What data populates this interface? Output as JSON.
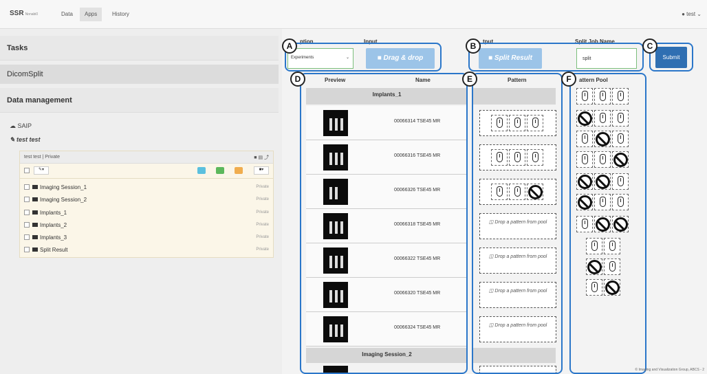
{
  "topbar": {
    "brand": "SSR",
    "brand_sub": "Nonabi0",
    "nav": [
      "Data",
      "Apps",
      "History"
    ],
    "user": "test"
  },
  "left": {
    "tasks_title": "Tasks",
    "task_item": "DicomSplit",
    "data_title": "Data management",
    "saip": "SAIP",
    "test_test": "test test",
    "tree_owner": "test test",
    "tree_visibility": "Private",
    "items": [
      {
        "label": "Imaging Session_1",
        "visibility": "Private"
      },
      {
        "label": "Imaging Session_2",
        "visibility": "Private"
      },
      {
        "label": "Implants_1",
        "visibility": "Private"
      },
      {
        "label": "Implants_2",
        "visibility": "Private"
      },
      {
        "label": "Implants_3",
        "visibility": "Private"
      },
      {
        "label": "Split Result",
        "visibility": "Private"
      }
    ],
    "colors": {
      "blue": "#5bc0de",
      "green": "#5cb85c",
      "orange": "#f0ad4e"
    }
  },
  "callouts": {
    "a": "A",
    "b": "B",
    "c": "C",
    "d": "D",
    "e": "E",
    "f": "F"
  },
  "form": {
    "option_label": "ption",
    "option_value": "Experiments",
    "input_label": "Input",
    "drag_drop": "Drag & drop",
    "output_label": "tput",
    "split_result": "Split Result",
    "job_label": "Split Job Name",
    "job_value": "split",
    "submit": "Submit"
  },
  "table": {
    "preview_header": "Preview",
    "name_header": "Name",
    "pattern_header": "Pattern",
    "pool_header": "attern Pool",
    "group1": "Implants_1",
    "group2": "Imaging Session_2",
    "rows": [
      {
        "name": "00066314 TSE45 MR",
        "pattern": [
          "mouse",
          "mouse",
          "mouse"
        ]
      },
      {
        "name": "00066316 TSE45 MR",
        "pattern": [
          "mouse",
          "mouse",
          "mouse"
        ]
      },
      {
        "name": "00066326 TSE45 MR",
        "pattern": [
          "mouse",
          "mouse",
          "no"
        ]
      },
      {
        "name": "00066318 TSE45 MR",
        "pattern": null
      },
      {
        "name": "00066322 TSE45 MR",
        "pattern": null
      },
      {
        "name": "00066320 TSE45 MR",
        "pattern": null
      },
      {
        "name": "00066324 TSE45 MR",
        "pattern": null
      }
    ],
    "drop_text": "Drop a pattern from pool"
  },
  "pool": [
    [
      "mouse",
      "mouse",
      "mouse"
    ],
    [
      "no",
      "mouse",
      "mouse"
    ],
    [
      "mouse",
      "no",
      "mouse"
    ],
    [
      "mouse",
      "mouse",
      "no"
    ],
    [
      "no",
      "no",
      "mouse"
    ],
    [
      "no",
      "mouse",
      "mouse"
    ],
    [
      "mouse",
      "no",
      "no"
    ],
    [
      "mouse",
      "mouse"
    ],
    [
      "no",
      "mouse"
    ],
    [
      "mouse",
      "no"
    ]
  ],
  "footer": "© Imaging and Visualization Group, ABCS - 2"
}
